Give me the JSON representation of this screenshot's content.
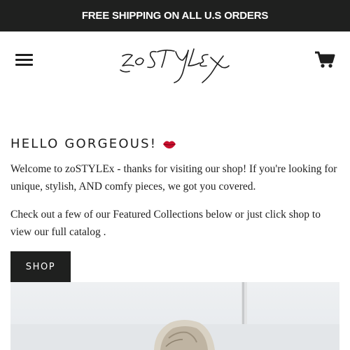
{
  "announcement": {
    "text": "FREE SHIPPING ON ALL U.S ORDERS"
  },
  "header": {
    "logo_text": "zoSTYLEx",
    "menu_icon": "hamburger-menu-icon",
    "cart_icon": "shopping-cart-icon"
  },
  "intro": {
    "heading": "HELLO GORGEOUS!",
    "heading_emoji": "kiss-lips-icon",
    "paragraph_1": "Welcome to zoSTYLEx - thanks for visiting our shop! If you're looking for unique, stylish, AND comfy pieces, we got you covered.",
    "paragraph_2": "Check out a few of our Featured Collections below or just click shop to view our full catalog ."
  },
  "cta": {
    "shop_label": "SHOP"
  },
  "colors": {
    "bar_bg": "#1f201f",
    "text": "#1e1e1e",
    "lips": "#c8102e"
  }
}
